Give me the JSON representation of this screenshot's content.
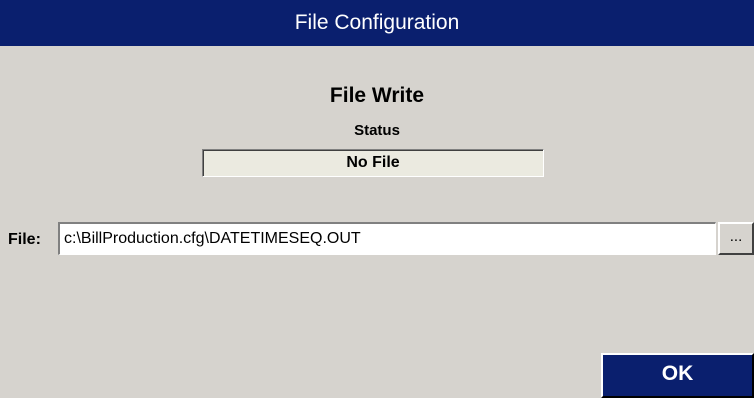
{
  "window": {
    "title": "File Configuration"
  },
  "section": {
    "title": "File Write",
    "status_label": "Status",
    "status_value": "No File"
  },
  "file": {
    "label": "File:",
    "value": "c:\\BillProduction.cfg\\DATETIMESEQ.OUT",
    "browse_label": "..."
  },
  "buttons": {
    "ok_label": "OK"
  },
  "colors": {
    "title_bar": "#0a1f6e",
    "dialog_background": "#d6d3ce",
    "status_box_background": "#ebeae0",
    "ok_button": "#0a1f6e"
  }
}
